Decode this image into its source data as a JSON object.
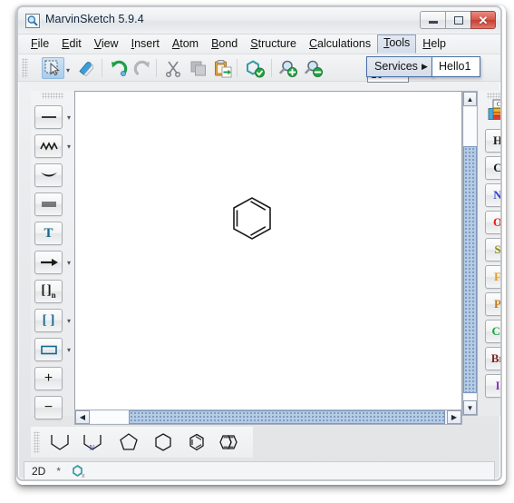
{
  "window": {
    "title": "MarvinSketch 5.9.4",
    "icon": "marvin-magnifier-icon",
    "controls": {
      "minimize": "minimize-button",
      "maximize": "maximize-button",
      "close_glyph": "✕"
    }
  },
  "menubar": {
    "items": [
      {
        "label": "File",
        "accel": "F",
        "open": false
      },
      {
        "label": "Edit",
        "accel": "E",
        "open": false
      },
      {
        "label": "View",
        "accel": "V",
        "open": false
      },
      {
        "label": "Insert",
        "accel": "I",
        "open": false
      },
      {
        "label": "Atom",
        "accel": "A",
        "open": false
      },
      {
        "label": "Bond",
        "accel": "B",
        "open": false
      },
      {
        "label": "Structure",
        "accel": "S",
        "open": false
      },
      {
        "label": "Calculations",
        "accel": "C",
        "open": false
      },
      {
        "label": "Tools",
        "accel": "T",
        "open": true
      },
      {
        "label": "Help",
        "accel": "H",
        "open": false
      }
    ]
  },
  "dropdown": {
    "item_label": "Services",
    "arrow": "▶",
    "submenu_label": "Hello1"
  },
  "toolbar": {
    "zoom_value": "10",
    "buttons": [
      {
        "name": "selection-tool",
        "selected": true
      },
      {
        "name": "eraser-tool",
        "selected": false
      },
      {
        "name": "undo-button",
        "selected": false
      },
      {
        "name": "redo-button",
        "selected": false
      },
      {
        "name": "cut-button",
        "selected": false
      },
      {
        "name": "copy-button",
        "selected": false
      },
      {
        "name": "paste-button",
        "selected": false
      },
      {
        "name": "clean-structure-button",
        "selected": false
      },
      {
        "name": "zoom-in-button",
        "selected": false
      },
      {
        "name": "zoom-out-button",
        "selected": false
      }
    ]
  },
  "left_palette": {
    "tools": [
      {
        "name": "single-bond-tool",
        "has_dropdown": true
      },
      {
        "name": "chain-tool",
        "has_dropdown": true
      },
      {
        "name": "wedge-bond-tool",
        "has_dropdown": false
      },
      {
        "name": "hash-bond-tool",
        "has_dropdown": false
      },
      {
        "name": "text-tool",
        "has_dropdown": false,
        "glyph": "T"
      },
      {
        "name": "reaction-arrow-tool",
        "has_dropdown": true
      },
      {
        "name": "repeating-unit-bracket-tool",
        "has_dropdown": false,
        "glyph": "[ ]n"
      },
      {
        "name": "bracket-tool",
        "has_dropdown": true,
        "glyph": "[ ]"
      },
      {
        "name": "rectangle-tool",
        "has_dropdown": true
      },
      {
        "name": "plus-tool",
        "has_dropdown": false,
        "glyph": "+"
      },
      {
        "name": "minus-tool",
        "has_dropdown": false,
        "glyph": "−"
      }
    ]
  },
  "right_palette": {
    "periodic_table_icon": "periodic-table-icon",
    "elements": [
      {
        "symbol": "H",
        "color": "#1a1a1a"
      },
      {
        "symbol": "C",
        "color": "#1a1a1a"
      },
      {
        "symbol": "N",
        "color": "#2c3fcf"
      },
      {
        "symbol": "O",
        "color": "#e81d16"
      },
      {
        "symbol": "S",
        "color": "#8c8c19"
      },
      {
        "symbol": "F",
        "color": "#e89a20"
      },
      {
        "symbol": "P",
        "color": "#c07a16"
      },
      {
        "symbol": "Cl",
        "color": "#14a83c"
      },
      {
        "symbol": "Br",
        "color": "#7a2520"
      },
      {
        "symbol": "I",
        "color": "#8a33bf"
      }
    ]
  },
  "canvas": {
    "structure": "benzene-ring",
    "structure_description": "benzene Kekule ring with three double bonds"
  },
  "scrollbars": {
    "vertical": {
      "up_arrow": "▲",
      "down_arrow": "▼"
    },
    "horizontal": {
      "left_arrow": "◀",
      "right_arrow": "▶"
    }
  },
  "template_bar": {
    "items": [
      {
        "name": "template-cyclopentane-open"
      },
      {
        "name": "template-pyrrole",
        "label": "N"
      },
      {
        "name": "template-cyclopentane"
      },
      {
        "name": "template-cyclohexane"
      },
      {
        "name": "template-benzene"
      },
      {
        "name": "template-naphthalene"
      }
    ]
  },
  "statusbar": {
    "dimension": "2D",
    "modified_marker": "*",
    "icon": "clean-structure-status-icon"
  }
}
